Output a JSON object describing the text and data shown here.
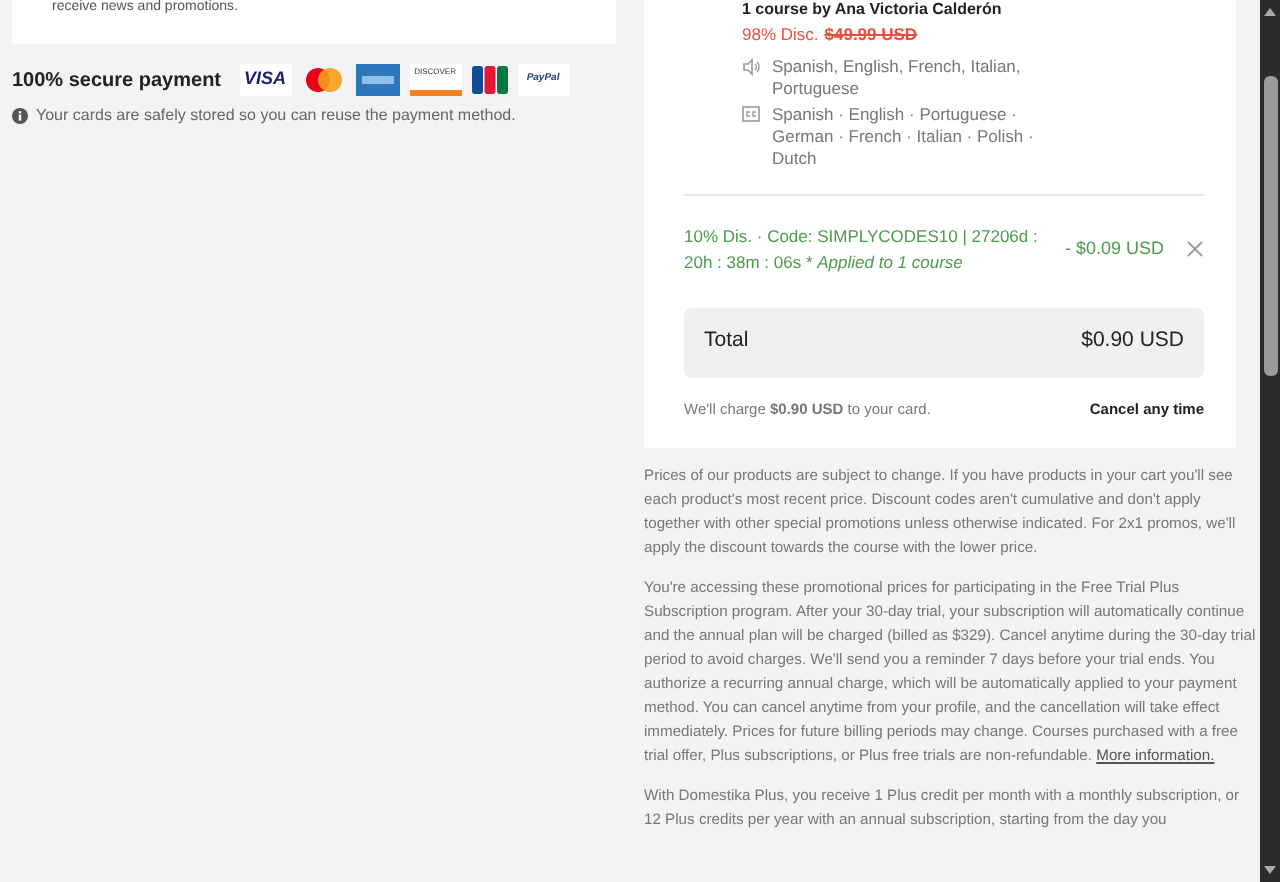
{
  "newsletter": {
    "text": "receive news and promotions."
  },
  "secure_payment": {
    "title": "100% secure payment",
    "cards": [
      {
        "kind": "visa",
        "label": "VISA"
      },
      {
        "kind": "mastercard"
      },
      {
        "kind": "amex"
      },
      {
        "kind": "discover",
        "label": "DISCOVER"
      },
      {
        "kind": "jcb"
      },
      {
        "kind": "paypal",
        "label": "PayPal"
      }
    ],
    "note": "Your cards are safely stored so you can reuse the payment method."
  },
  "course": {
    "byline": "1 course by Ana Victoria Calderón",
    "discount": "98% Disc.",
    "old_price": "$49.99 USD",
    "audio": "Spanish, English, French, Italian, Portuguese",
    "subtitles": "Spanish · English · Portuguese · German · French · Italian · Polish · Dutch"
  },
  "promo": {
    "text": "10% Dis. · Code: SIMPLYCODES10 | 27206d : 20h : 38m : 06s * *Applied to 1 course*",
    "amount": "- $0.09 USD"
  },
  "total": {
    "label": "Total",
    "amount": "$0.90 USD"
  },
  "charge": {
    "text": "We'll charge **$0.90 USD** to your card.",
    "cancel": "Cancel any time"
  },
  "legal": [
    {
      "text": "Prices of our products are subject to change. If you have products in your cart you'll see each product's most recent price. Discount codes aren't cumulative and don't apply together with other special promotions unless otherwise indicated. For 2x1 promos, we'll apply the discount towards the course with the lower price."
    },
    {
      "text": "You're accessing these promotional prices for participating in the Free Trial Plus Subscription program. After your 30-day trial, your subscription will automatically continue and the annual plan will be charged (billed as $329). Cancel anytime during the 30-day trial period to avoid charges. We'll send you a reminder 7 days before your trial ends. You authorize a recurring annual charge, which will be automatically applied to your payment method. You can cancel anytime from your profile, and the cancellation will take effect immediately. Prices for future billing periods may change. Courses purchased with a free trial offer, Plus subscriptions, or Plus free trials are non-refundable.",
      "link": "More information."
    },
    {
      "text": "With Domestika Plus, you receive 1 Plus credit per month with a monthly subscription, or 12 Plus credits per year with an annual subscription, starting from the day you"
    }
  ]
}
